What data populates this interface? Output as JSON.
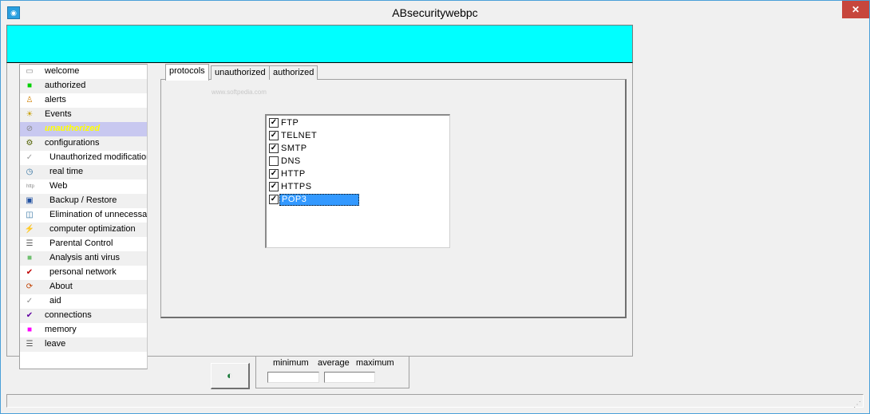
{
  "window": {
    "title": "ABsecuritywebpc",
    "icon": "app-icon",
    "close_label": "✕"
  },
  "sidebar": {
    "items": [
      {
        "label": "welcome",
        "icon": "monitor-icon",
        "level": 0
      },
      {
        "label": "authorized",
        "icon": "green-square-icon",
        "level": 0
      },
      {
        "label": "alerts",
        "icon": "person-alert-icon",
        "level": 0
      },
      {
        "label": "Events",
        "icon": "lightbulb-icon",
        "level": 0
      },
      {
        "label": "unauthorized",
        "icon": "no-entry-icon",
        "level": 0,
        "selected": true
      },
      {
        "label": "configurations",
        "icon": "settings-disk-icon",
        "level": 0
      },
      {
        "label": "Unauthorized modification",
        "icon": "check-icon",
        "level": 1
      },
      {
        "label": "real time",
        "icon": "clock-icon",
        "level": 1
      },
      {
        "label": "Web",
        "icon": "http-icon",
        "level": 1
      },
      {
        "label": "Backup / Restore",
        "icon": "backup-disk-icon",
        "level": 1
      },
      {
        "label": "Elimination of unnecessary",
        "icon": "trash-icon",
        "level": 1
      },
      {
        "label": "computer optimization",
        "icon": "wand-icon",
        "level": 1
      },
      {
        "label": "Parental Control",
        "icon": "list-icon",
        "level": 1
      },
      {
        "label": "Analysis anti virus",
        "icon": "shield-icon",
        "level": 1
      },
      {
        "label": "personal network",
        "icon": "network-check-icon",
        "level": 1
      },
      {
        "label": "About",
        "icon": "info-arrows-icon",
        "level": 1
      },
      {
        "label": "aid",
        "icon": "help-check-icon",
        "level": 1
      },
      {
        "label": "connections",
        "icon": "link-check-icon",
        "level": 0
      },
      {
        "label": "memory",
        "icon": "magenta-square-icon",
        "level": 0
      },
      {
        "label": "leave",
        "icon": "exit-list-icon",
        "level": 0
      }
    ]
  },
  "tabs": [
    {
      "label": "protocols",
      "active": true
    },
    {
      "label": "unauthorized",
      "active": false
    },
    {
      "label": "authorized",
      "active": false
    }
  ],
  "watermark": "www.softpedia.com",
  "protocols": [
    {
      "label": "FTP",
      "checked": true
    },
    {
      "label": "TELNET",
      "checked": true
    },
    {
      "label": "SMTP",
      "checked": true
    },
    {
      "label": "DNS",
      "checked": false
    },
    {
      "label": "HTTP",
      "checked": true
    },
    {
      "label": "HTTPS",
      "checked": true
    },
    {
      "label": "POP3",
      "checked": true,
      "selected": true
    }
  ],
  "stats": {
    "minimum_label": "minimum",
    "average_label": "average",
    "maximum_label": "maximum",
    "minimum_value": "",
    "average_value": ""
  },
  "colors": {
    "banner": "#00ffff",
    "selection": "#3399ff",
    "sidebar_selected": "#c8c8f0"
  }
}
